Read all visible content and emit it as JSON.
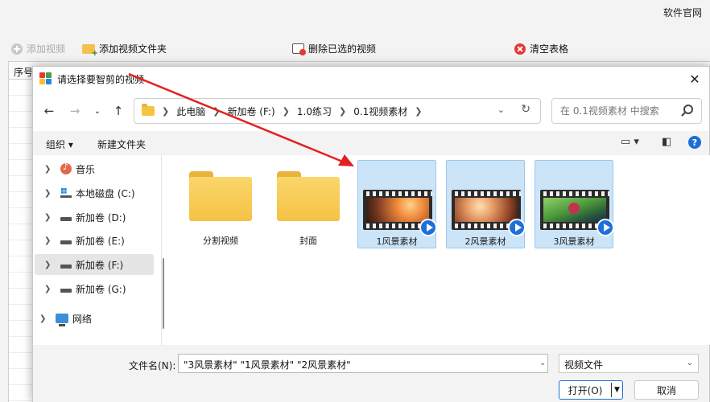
{
  "app": {
    "brand": "软件官网",
    "toolbar": {
      "add_video": "添加视频",
      "add_folder": "添加视频文件夹",
      "delete_selected": "删除已选的视频",
      "clear_table": "清空表格"
    },
    "table_header": "序号"
  },
  "dialog": {
    "title": "请选择要智剪的视频",
    "breadcrumb": [
      "此电脑",
      "新加卷 (F:)",
      "1.0练习",
      "0.1视频素材"
    ],
    "search_placeholder": "在 0.1视频素材 中搜索",
    "commands": {
      "organize": "组织 ▾",
      "new_folder": "新建文件夹"
    },
    "sidebar": [
      {
        "label": "音乐",
        "icon": "music-icon"
      },
      {
        "label": "本地磁盘 (C:)",
        "icon": "drive-icon"
      },
      {
        "label": "新加卷 (D:)",
        "icon": "drive-icon"
      },
      {
        "label": "新加卷 (E:)",
        "icon": "drive-icon"
      },
      {
        "label": "新加卷 (F:)",
        "icon": "drive-icon",
        "selected": true
      },
      {
        "label": "新加卷 (G:)",
        "icon": "drive-icon"
      },
      {
        "label": "网络",
        "icon": "network-icon"
      }
    ],
    "files": [
      {
        "name": "分割视频",
        "type": "folder",
        "selected": false
      },
      {
        "name": "封面",
        "type": "folder",
        "selected": false
      },
      {
        "name": "1风景素材",
        "type": "video",
        "selected": true
      },
      {
        "name": "2风景素材",
        "type": "video",
        "selected": true
      },
      {
        "name": "3风景素材",
        "type": "video",
        "selected": true
      }
    ],
    "footer": {
      "filename_label": "文件名(N):",
      "filename_value": "\"3风景素材\" \"1风景素材\" \"2风景素材\"",
      "filetype": "视频文件",
      "open_label": "打开(O)",
      "cancel_label": "取消"
    }
  },
  "colors": {
    "accent": "#1a6fd4",
    "selection": "#cce4f7",
    "annotation_arrow": "#e32020"
  }
}
